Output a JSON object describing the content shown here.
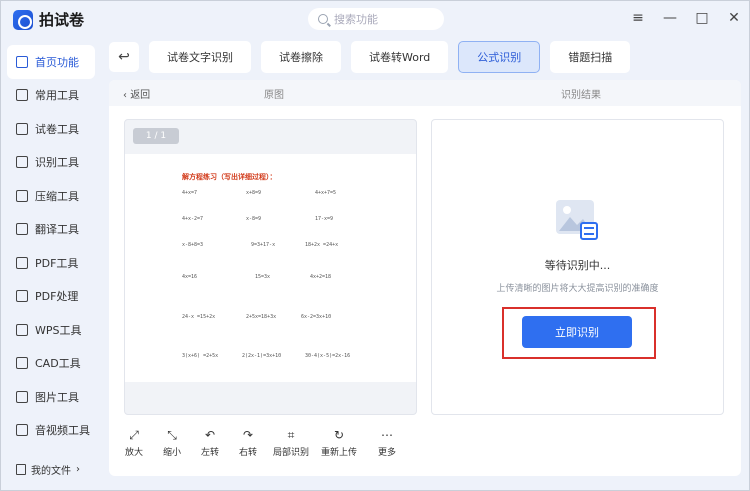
{
  "app": {
    "name": "拍试卷"
  },
  "search": {
    "placeholder": "搜索功能"
  },
  "window_controls": [
    "≡",
    "—",
    "□",
    "✕"
  ],
  "sidebar": {
    "items": [
      {
        "label": "首页功能",
        "icon": "home-icon",
        "active": true
      },
      {
        "label": "常用工具",
        "icon": "layers-icon"
      },
      {
        "label": "试卷工具",
        "icon": "paper-icon"
      },
      {
        "label": "识别工具",
        "icon": "scan-icon"
      },
      {
        "label": "压缩工具",
        "icon": "compress-icon"
      },
      {
        "label": "翻译工具",
        "icon": "translate-icon"
      },
      {
        "label": "PDF工具",
        "icon": "pdf-icon"
      },
      {
        "label": "PDF处理",
        "icon": "pdf-process-icon"
      },
      {
        "label": "WPS工具",
        "icon": "wps-icon"
      },
      {
        "label": "CAD工具",
        "icon": "cad-icon"
      },
      {
        "label": "图片工具",
        "icon": "image-icon"
      },
      {
        "label": "音视频工具",
        "icon": "media-icon"
      }
    ],
    "my_files": "我的文件"
  },
  "tabs": [
    {
      "label": "试卷文字识别"
    },
    {
      "label": "试卷擦除"
    },
    {
      "label": "试卷转Word"
    },
    {
      "label": "公式识别",
      "active": true
    },
    {
      "label": "错题扫描"
    }
  ],
  "main": {
    "back": "返回",
    "original_label": "原图",
    "result_label": "识别结果",
    "page_badge": "1 / 1",
    "paper_title": "解方程练习（写出详细过程）：",
    "equations": [
      [
        "4+x=7",
        "x+8=9",
        "4+x+7=5"
      ],
      [
        "4+x-2=7",
        "x-8=9",
        "17-x=9"
      ],
      [
        "x-8+8=3",
        "9=3+17-x",
        "18+2x =24+x"
      ],
      [
        "4x=16",
        "15=3x",
        "4x+2=18"
      ],
      [
        "24-x =15+2x",
        "2+5x=18+3x",
        "6x-2=3x+10"
      ],
      [
        "3(x+6) =2+5x",
        "2(2x-1)=3x+10",
        "30-4(x-5)=2x-16"
      ]
    ],
    "waiting": "等待识别中...",
    "hint": "上传清晰的图片将大大提高识别的准确度",
    "recognize_button": "立即识别"
  },
  "tools": [
    {
      "label": "放大",
      "icon": "expand-icon"
    },
    {
      "label": "缩小",
      "icon": "shrink-icon"
    },
    {
      "label": "左转",
      "icon": "rotate-left-icon"
    },
    {
      "label": "右转",
      "icon": "rotate-right-icon"
    },
    {
      "label": "局部识别",
      "icon": "crop-icon"
    },
    {
      "label": "重新上传",
      "icon": "reupload-icon"
    },
    {
      "label": "更多",
      "icon": "more-icon"
    }
  ],
  "colors": {
    "accent": "#2f6ff0",
    "highlight": "#d9302b",
    "paper_title": "#d23a1a"
  }
}
